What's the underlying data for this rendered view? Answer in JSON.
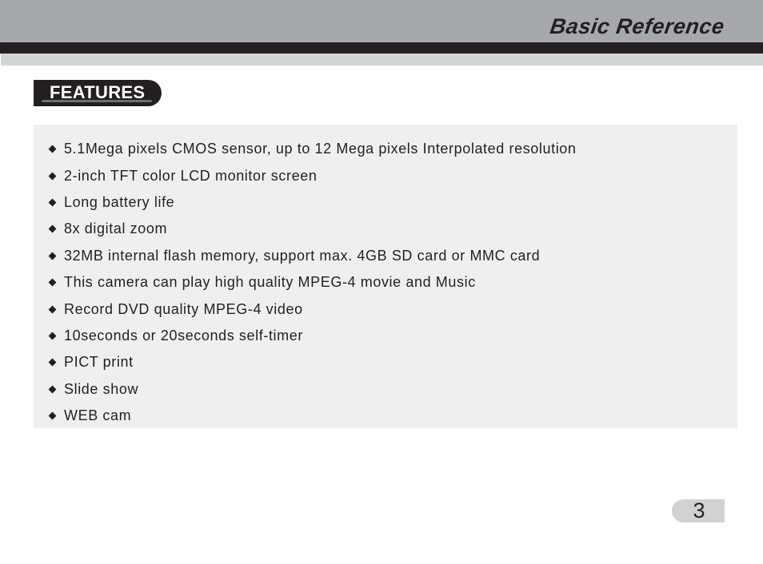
{
  "header": {
    "section_title": "Basic Reference"
  },
  "section": {
    "badge_label": "FEATURES",
    "bullet_icon": "diamond-bullet-icon",
    "features": [
      "5.1Mega pixels CMOS sensor, up to 12 Mega pixels Interpolated resolution",
      "2-inch TFT color LCD monitor screen",
      "Long battery life",
      "8x digital zoom",
      "32MB internal flash memory, support max. 4GB SD card or MMC card",
      "This camera can play high quality MPEG-4 movie and Music",
      "Record DVD quality MPEG-4 video",
      "10seconds or 20seconds self-timer",
      "PICT print",
      "Slide show",
      "WEB cam"
    ]
  },
  "footer": {
    "page_number": "3"
  },
  "colors": {
    "header_gray": "#a7a8ab",
    "header_black": "#231f20",
    "header_light": "#d3d4d6",
    "content_bg": "#efefef",
    "page_pill": "#d1d2d4",
    "text": "#231f20"
  }
}
